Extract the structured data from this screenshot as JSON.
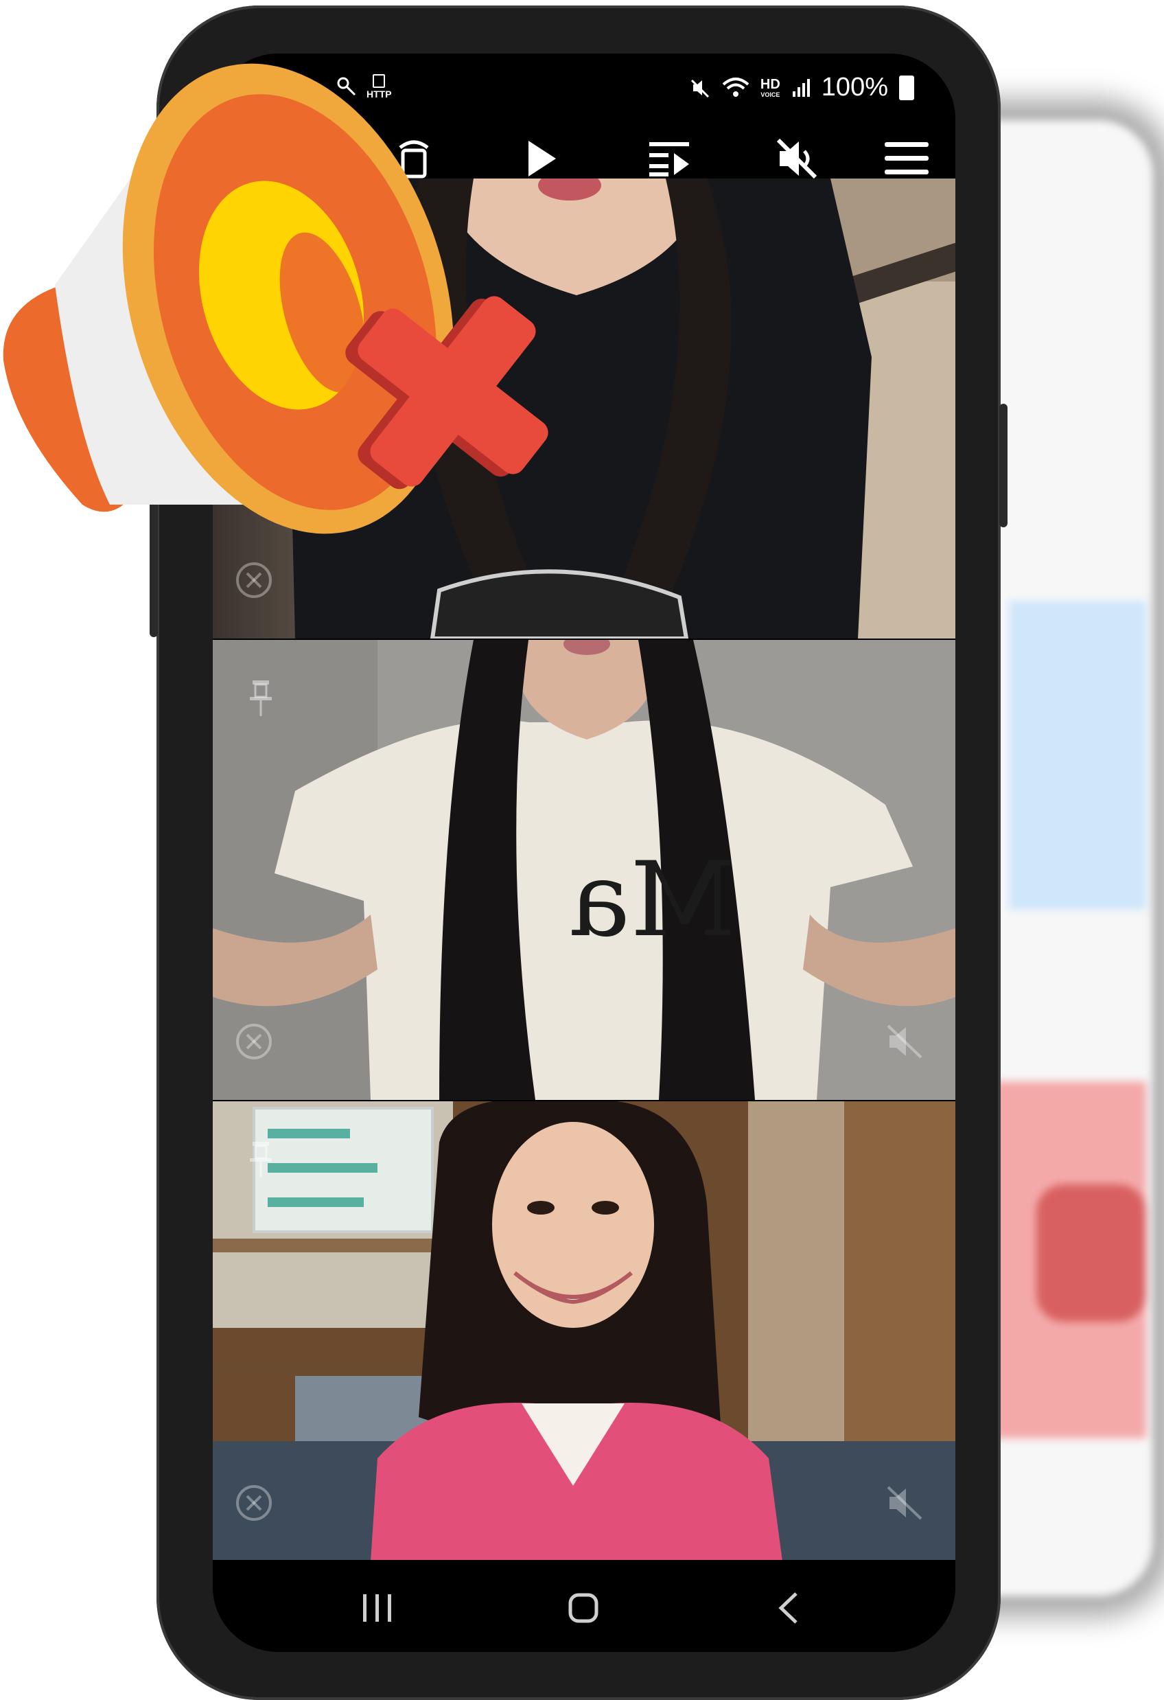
{
  "status_bar": {
    "left_icons": [
      "key-icon",
      "http-icon"
    ],
    "http_label": "HTTP",
    "right_icons": [
      "mute-icon",
      "wifi-icon",
      "hd-voice-icon",
      "signal-icon"
    ],
    "hd_label": "HD",
    "voice_label": "VOICE",
    "battery_percent": "100%"
  },
  "toolbar": {
    "buttons": [
      "rotate-icon",
      "play-icon",
      "playlist-icon",
      "mute-icon",
      "menu-icon"
    ]
  },
  "feed": {
    "tiles": [
      {
        "id": "video-1",
        "pinned": false,
        "closable": true,
        "muted": false
      },
      {
        "id": "video-2",
        "pinned": true,
        "closable": true,
        "muted": true,
        "shirt_text": "Ma"
      },
      {
        "id": "video-3",
        "pinned": true,
        "closable": true,
        "muted": true
      }
    ]
  },
  "nav_bar": {
    "buttons": [
      "recent-apps-icon",
      "home-icon",
      "back-icon"
    ]
  },
  "overlay": {
    "graphic": "megaphone-muted-icon"
  },
  "colors": {
    "phone_body": "#1d1d1d",
    "screen_bg": "#000000",
    "megaphone_orange": "#ec6a2b",
    "megaphone_light_orange": "#f0a83c",
    "megaphone_yellow": "#ffd400",
    "megaphone_white": "#eeeeee",
    "cross_red": "#e84a3c",
    "cross_dark_red": "#b8302a",
    "vest_pink": "#e2507a"
  }
}
